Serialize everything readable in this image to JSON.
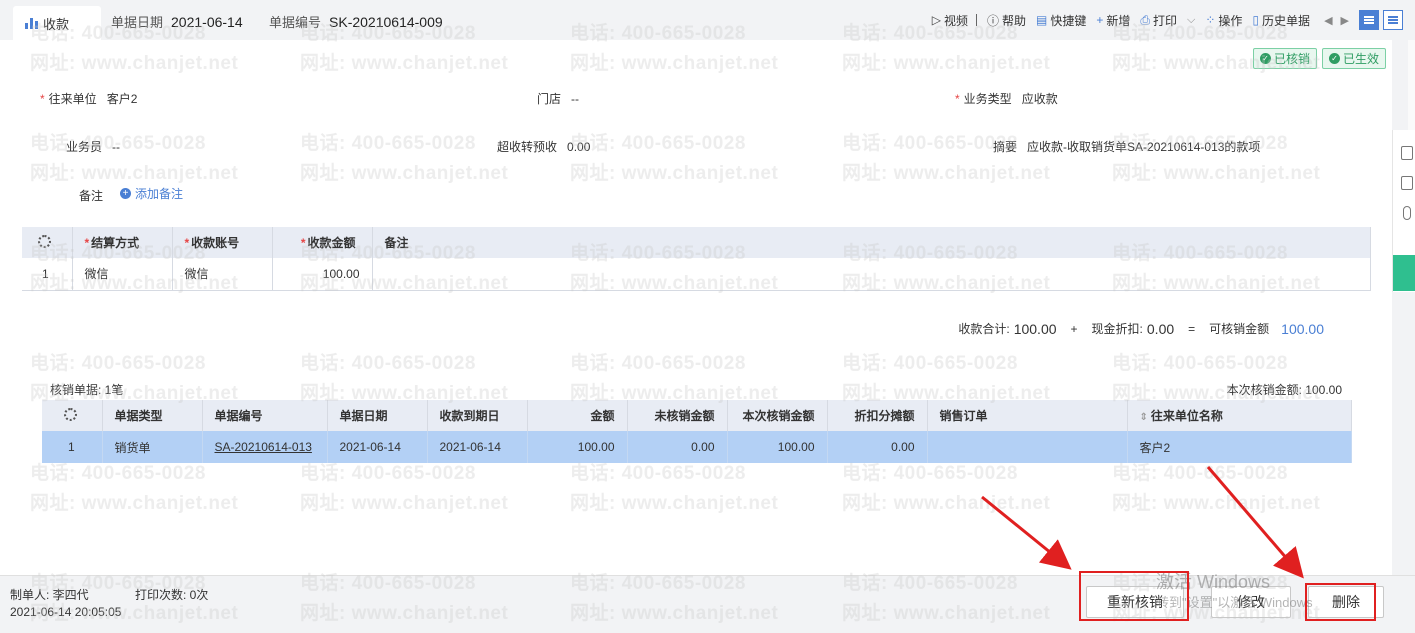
{
  "tab": {
    "title": "收款"
  },
  "header": {
    "date_label": "单据日期",
    "date_value": "2021-06-14",
    "code_label": "单据编号",
    "code_value": "SK-20210614-009"
  },
  "toolbar": {
    "video": "视频",
    "help": "帮助",
    "shortcut": "快捷键",
    "add": "新增",
    "print": "打印",
    "operate": "操作",
    "history": "历史单据"
  },
  "badges": {
    "verified": "已核销",
    "effective": "已生效"
  },
  "form": {
    "partner_label": "往来单位",
    "partner_value": "客户2",
    "store_label": "门店",
    "store_value": "--",
    "biz_type_label": "业务类型",
    "biz_type_value": "应收款",
    "salesman_label": "业务员",
    "salesman_value": "--",
    "over_label": "超收转预收",
    "over_value": "0.00",
    "summary_label": "摘要",
    "summary_value": "应收款-收取销货单SA-20210614-013的款项",
    "note_label": "备注",
    "add_note": "添加备注"
  },
  "payment_table": {
    "headers": [
      "结算方式",
      "收款账号",
      "收款金额",
      "备注"
    ],
    "rows": [
      {
        "idx": "1",
        "method": "微信",
        "account": "微信",
        "amount": "100.00",
        "note": ""
      }
    ]
  },
  "totals": {
    "receipt_label": "收款合计:",
    "receipt_value": "100.00",
    "plus": "+",
    "discount_label": "现金折扣:",
    "discount_value": "0.00",
    "equals": "=",
    "verifiable_label": "可核销金额",
    "verifiable_value": "100.00"
  },
  "verify": {
    "count_text": "核销单据: 1笔",
    "amount_text": "本次核销金额: 100.00"
  },
  "verify_table": {
    "headers": [
      "单据类型",
      "单据编号",
      "单据日期",
      "收款到期日",
      "金额",
      "未核销金额",
      "本次核销金额",
      "折扣分摊额",
      "销售订单",
      "往来单位名称"
    ],
    "rows": [
      {
        "idx": "1",
        "type": "销货单",
        "code": "SA-20210614-013",
        "date": "2021-06-14",
        "due": "2021-06-14",
        "amount": "100.00",
        "unverified": "0.00",
        "this": "100.00",
        "discount": "0.00",
        "order": "",
        "partner": "客户2"
      }
    ]
  },
  "footer": {
    "maker": "制单人: 李四代",
    "print_count": "打印次数: 0次",
    "time": "2021-06-14 20:05:05",
    "reverify": "重新核销",
    "edit": "修改",
    "delete": "删除"
  },
  "watermark": {
    "phone": "电话: 400-665-0028",
    "site": "网址: www.chanjet.net"
  },
  "windows": {
    "line1": "激活 Windows",
    "line2": "转到\"设置\"以激活 Windows"
  }
}
